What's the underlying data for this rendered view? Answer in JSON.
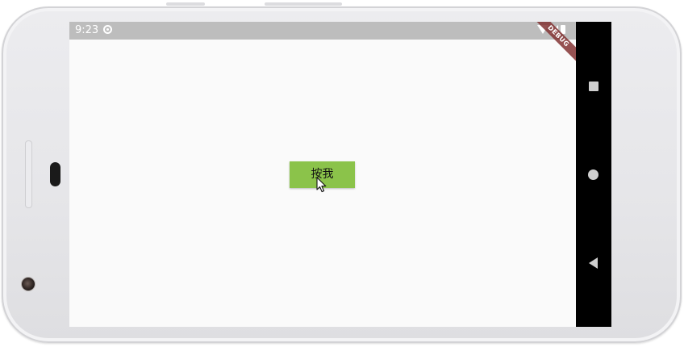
{
  "status_bar": {
    "time": "9:23"
  },
  "debug_banner": {
    "label": "DEBUG"
  },
  "main": {
    "button_label": "按我"
  },
  "colors": {
    "button_bg": "#8bc34a",
    "status_bar_bg": "#bdbdbd",
    "screen_bg": "#fafafa",
    "nav_bar_bg": "#000000",
    "debug_banner_bg": "#823232"
  },
  "icons": {
    "status": [
      "sync-icon",
      "wifi-icon",
      "signal-icon",
      "battery-icon"
    ],
    "nav": [
      "recents-icon",
      "home-icon",
      "back-icon"
    ],
    "pointer": "cursor-icon"
  }
}
